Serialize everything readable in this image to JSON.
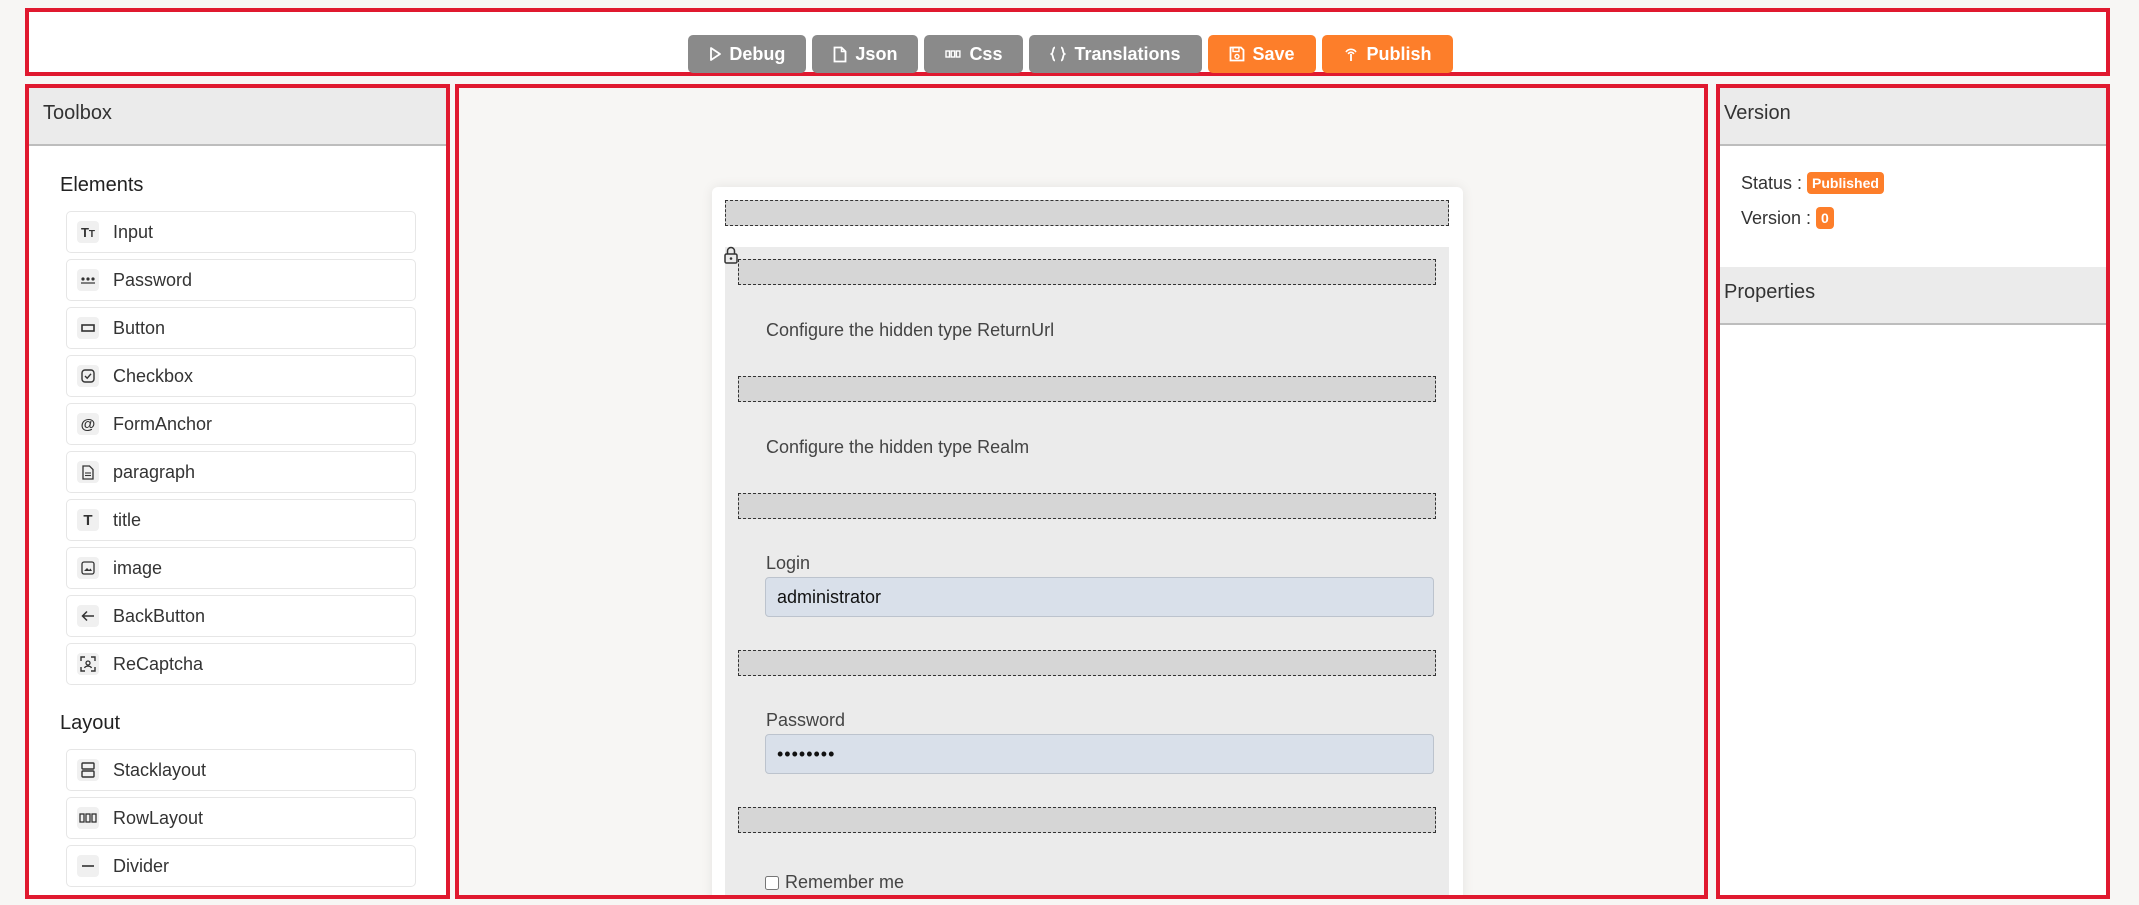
{
  "toolbar": {
    "debug": "Debug",
    "json": "Json",
    "css": "Css",
    "translations": "Translations",
    "save": "Save",
    "publish": "Publish"
  },
  "toolbox": {
    "title": "Toolbox",
    "elements_title": "Elements",
    "elements": [
      {
        "label": "Input",
        "icon": "text-type-icon"
      },
      {
        "label": "Password",
        "icon": "password-dots-icon"
      },
      {
        "label": "Button",
        "icon": "button-rect-icon"
      },
      {
        "label": "Checkbox",
        "icon": "checkbox-icon"
      },
      {
        "label": "FormAnchor",
        "icon": "at-sign-icon"
      },
      {
        "label": "paragraph",
        "icon": "document-icon"
      },
      {
        "label": "title",
        "icon": "title-t-icon"
      },
      {
        "label": "image",
        "icon": "image-icon"
      },
      {
        "label": "BackButton",
        "icon": "arrow-left-icon"
      },
      {
        "label": "ReCaptcha",
        "icon": "recaptcha-icon"
      }
    ],
    "layout_title": "Layout",
    "layout": [
      {
        "label": "Stacklayout",
        "icon": "stack-layout-icon"
      },
      {
        "label": "RowLayout",
        "icon": "row-layout-icon"
      },
      {
        "label": "Divider",
        "icon": "divider-icon"
      }
    ]
  },
  "form": {
    "hidden_returnurl": "Configure the hidden type ReturnUrl",
    "hidden_realm": "Configure the hidden type Realm",
    "login_label": "Login",
    "login_value": "administrator",
    "password_label": "Password",
    "password_value": "••••••••",
    "remember_label": "Remember me"
  },
  "version_panel": {
    "title": "Version",
    "status_label": "Status :",
    "status_value": "Published",
    "version_label": "Version :",
    "version_value": "0",
    "properties_title": "Properties"
  },
  "colors": {
    "accent": "#fd7e2a",
    "toolbar_gray": "#8a8a8a",
    "highlight_border": "#e0192f"
  }
}
